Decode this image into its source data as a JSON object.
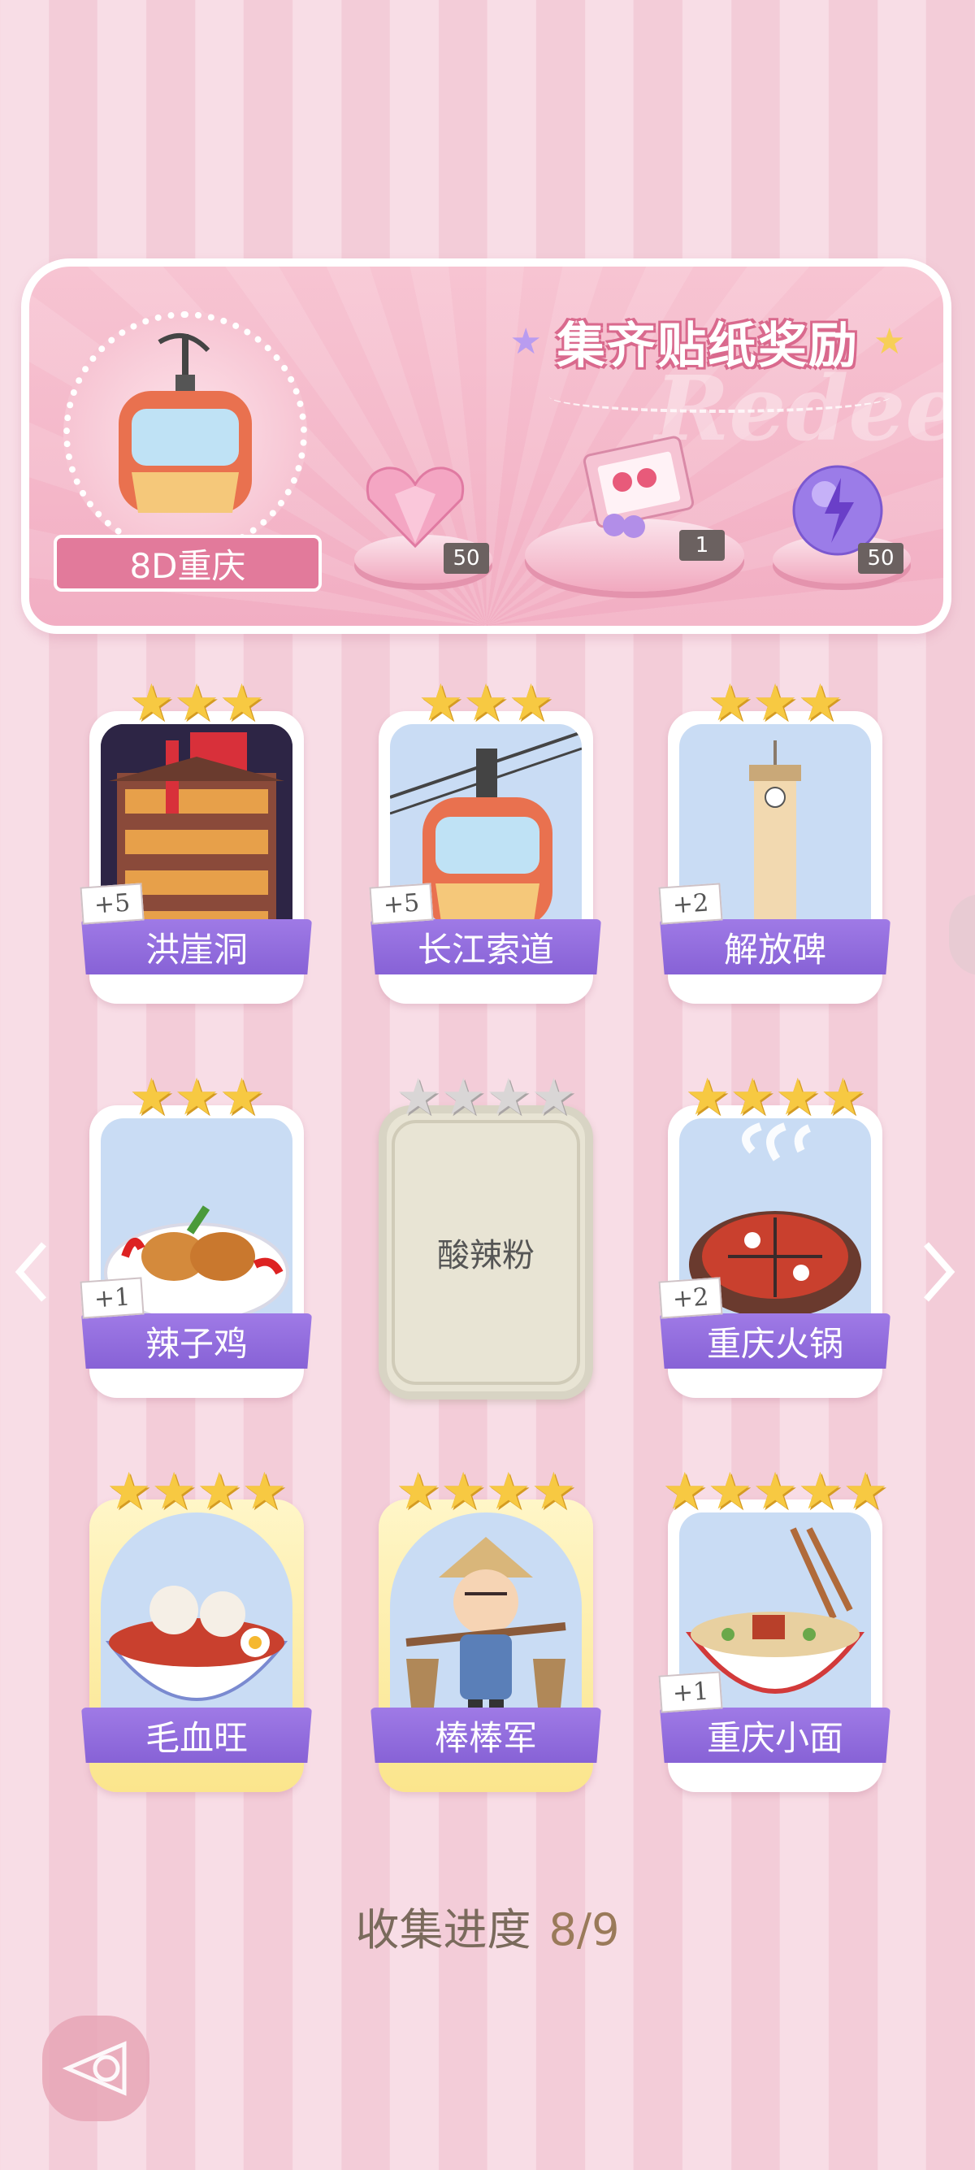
{
  "banner": {
    "title": "集齐贴纸奖励",
    "watermark": "Redeem",
    "city_label": "8D重庆",
    "rewards": [
      {
        "icon": "pink-heart-gem-icon",
        "count": "50"
      },
      {
        "icon": "gift-box-icon",
        "count": "1"
      },
      {
        "icon": "purple-energy-orb-icon",
        "count": "50"
      }
    ]
  },
  "cards": [
    {
      "name": "洪崖洞",
      "bonus": "+5",
      "stars": 3,
      "max_stars": 3,
      "locked": false,
      "gold": false,
      "icon": "hongyadong-building-icon"
    },
    {
      "name": "长江索道",
      "bonus": "+5",
      "stars": 3,
      "max_stars": 3,
      "locked": false,
      "gold": false,
      "icon": "cable-car-icon"
    },
    {
      "name": "解放碑",
      "bonus": "+2",
      "stars": 3,
      "max_stars": 3,
      "locked": false,
      "gold": false,
      "icon": "clock-tower-icon"
    },
    {
      "name": "辣子鸡",
      "bonus": "+1",
      "stars": 3,
      "max_stars": 3,
      "locked": false,
      "gold": false,
      "icon": "spicy-chicken-icon"
    },
    {
      "name": "酸辣粉",
      "bonus": "",
      "stars": 0,
      "max_stars": 4,
      "locked": true,
      "gold": false,
      "icon": ""
    },
    {
      "name": "重庆火锅",
      "bonus": "+2",
      "stars": 4,
      "max_stars": 4,
      "locked": false,
      "gold": false,
      "icon": "hotpot-icon"
    },
    {
      "name": "毛血旺",
      "bonus": "",
      "stars": 4,
      "max_stars": 4,
      "locked": false,
      "gold": true,
      "icon": "maoxuewang-bowl-icon"
    },
    {
      "name": "棒棒军",
      "bonus": "",
      "stars": 4,
      "max_stars": 4,
      "locked": false,
      "gold": true,
      "icon": "porter-boy-icon"
    },
    {
      "name": "重庆小面",
      "bonus": "+1",
      "stars": 5,
      "max_stars": 5,
      "locked": false,
      "gold": false,
      "icon": "noodle-bowl-icon"
    }
  ],
  "progress": {
    "label": "收集进度",
    "value": "8/9"
  },
  "colors": {
    "name_bar": "#8f6ae0",
    "star": "#f7c942",
    "banner_pink": "#f2aec3"
  }
}
